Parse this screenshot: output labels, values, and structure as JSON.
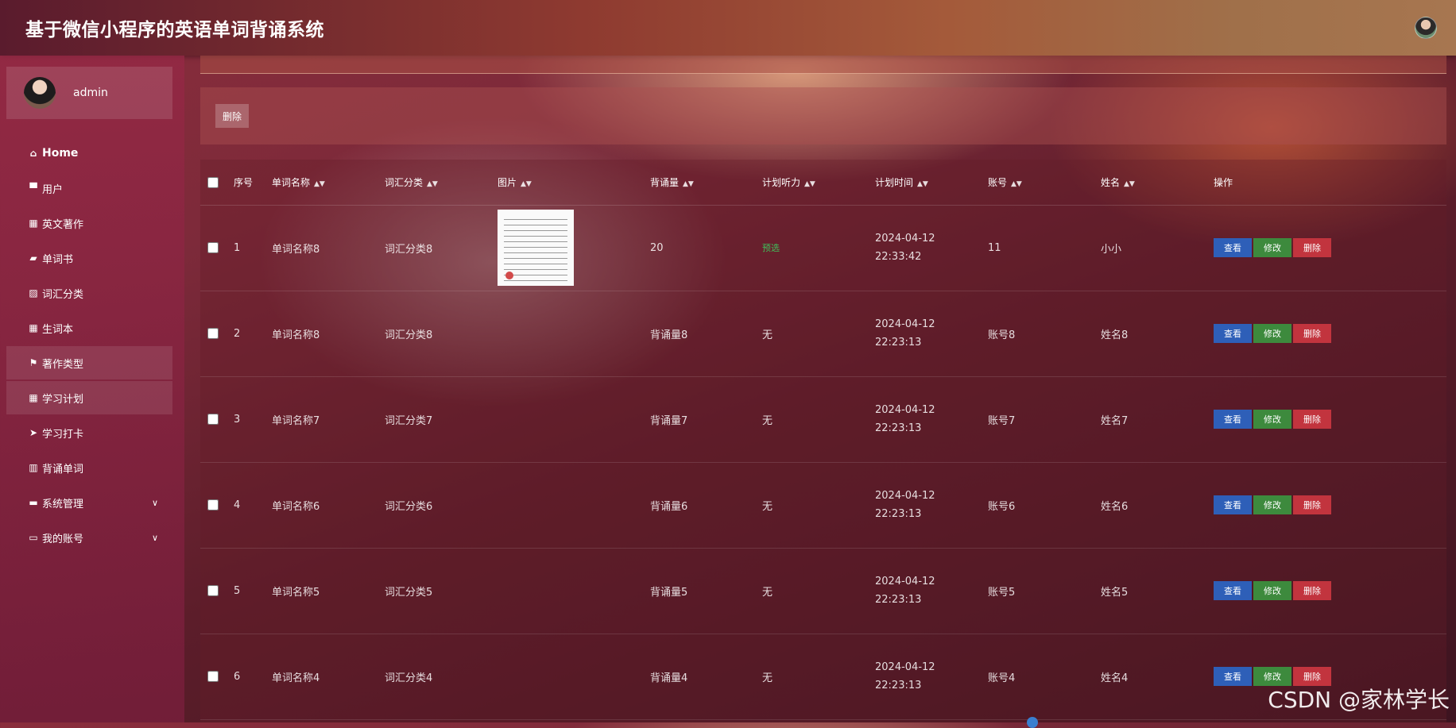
{
  "header": {
    "title": "基于微信小程序的英语单词背诵系统"
  },
  "user": {
    "name": "admin"
  },
  "sidebar": {
    "items": [
      {
        "label": "Home",
        "icon": "home-icon",
        "glyph": "⌂"
      },
      {
        "label": "用户",
        "icon": "user-icon",
        "glyph": "▀"
      },
      {
        "label": "英文著作",
        "icon": "grid-icon",
        "glyph": "▦"
      },
      {
        "label": "单词书",
        "icon": "book-icon",
        "glyph": "▰"
      },
      {
        "label": "词汇分类",
        "icon": "chart-icon",
        "glyph": "▨"
      },
      {
        "label": "生词本",
        "icon": "grid-icon",
        "glyph": "▦"
      },
      {
        "label": "著作类型",
        "icon": "flag-icon",
        "glyph": "⚑"
      },
      {
        "label": "学习计划",
        "icon": "grid-icon",
        "glyph": "▦"
      },
      {
        "label": "学习打卡",
        "icon": "send-icon",
        "glyph": "➤"
      },
      {
        "label": "背诵单词",
        "icon": "bar-chart-icon",
        "glyph": "▥"
      },
      {
        "label": "系统管理",
        "icon": "briefcase-icon",
        "glyph": "▬"
      },
      {
        "label": "我的账号",
        "icon": "card-icon",
        "glyph": "▭"
      }
    ]
  },
  "toolbar": {
    "delete_label": "删除"
  },
  "table": {
    "headers": [
      "序号",
      "单词名称",
      "词汇分类",
      "图片",
      "背诵量",
      "计划听力",
      "计划时间",
      "账号",
      "姓名",
      "操作"
    ],
    "rows": [
      {
        "index": "1",
        "word": "单词名称8",
        "category": "词汇分类8",
        "amount": "20",
        "listening": "预选",
        "time": "2024-04-12 22:33:42",
        "account": "11",
        "name": "小小"
      },
      {
        "index": "2",
        "word": "单词名称8",
        "category": "词汇分类8",
        "amount": "背诵量8",
        "listening": "无",
        "time": "2024-04-12 22:23:13",
        "account": "账号8",
        "name": "姓名8"
      },
      {
        "index": "3",
        "word": "单词名称7",
        "category": "词汇分类7",
        "amount": "背诵量7",
        "listening": "无",
        "time": "2024-04-12 22:23:13",
        "account": "账号7",
        "name": "姓名7"
      },
      {
        "index": "4",
        "word": "单词名称6",
        "category": "词汇分类6",
        "amount": "背诵量6",
        "listening": "无",
        "time": "2024-04-12 22:23:13",
        "account": "账号6",
        "name": "姓名6"
      },
      {
        "index": "5",
        "word": "单词名称5",
        "category": "词汇分类5",
        "amount": "背诵量5",
        "listening": "无",
        "time": "2024-04-12 22:23:13",
        "account": "账号5",
        "name": "姓名5"
      },
      {
        "index": "6",
        "word": "单词名称4",
        "category": "词汇分类4",
        "amount": "背诵量4",
        "listening": "无",
        "time": "2024-04-12 22:23:13",
        "account": "账号4",
        "name": "姓名4"
      }
    ],
    "actions": {
      "view": "查看",
      "edit": "修改",
      "delete": "删除"
    }
  },
  "watermark": "CSDN @家林学长"
}
